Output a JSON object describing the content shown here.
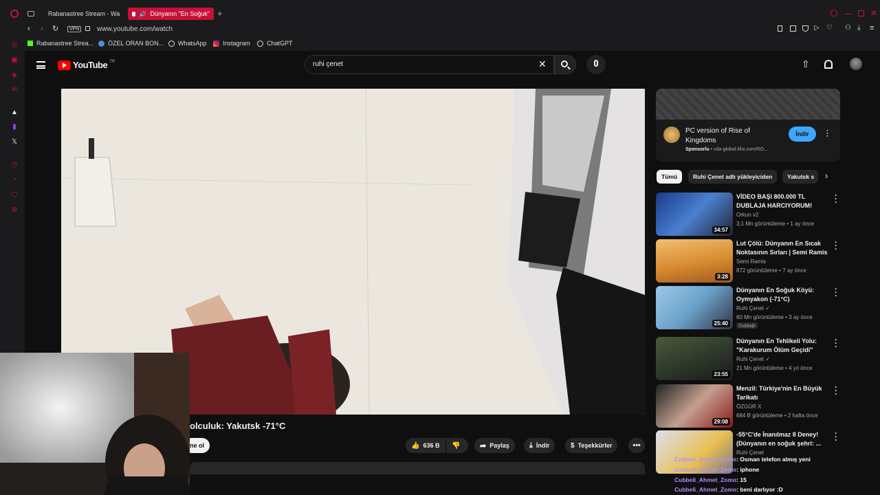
{
  "browser": {
    "tabs": [
      {
        "label": "Rabanastree Stream - Wa",
        "active": false
      },
      {
        "label": "Dünyanın \"En Soğuk\"",
        "active": true
      }
    ],
    "url_badge": "VPN",
    "url": "www.youtube.com/watch",
    "bookmarks": [
      {
        "label": "Rabanastree Strea...",
        "icon": "kick-icon"
      },
      {
        "label": "ÖZEL ORAN BON...",
        "icon": "globe-icon"
      },
      {
        "label": "WhatsApp",
        "icon": "whatsapp-icon"
      },
      {
        "label": "Instagram",
        "icon": "instagram-icon"
      },
      {
        "label": "ChatGPT",
        "icon": "chatgpt-icon"
      }
    ]
  },
  "youtube": {
    "logo_text": "YouTube",
    "logo_region": "TR",
    "search_value": "ruhi çenet",
    "video_title": "olculuk: Yakutsk -71°C",
    "subscribe_label": "ne ol",
    "like_count": "636 B",
    "share_label": "Paylaş",
    "download_label": "İndir",
    "thanks_label": "Teşekkürler"
  },
  "ad": {
    "title": "PC version of Rise of Kingdoms",
    "sponsor": "Sponsorlu",
    "domain": "vda-global.lilisi.com/RO...",
    "cta": "İndir"
  },
  "chips": [
    "Tümü",
    "Ruhi Çenet adlı yükleyiciden",
    "Yakutsk s"
  ],
  "recommended": [
    {
      "title": "VİDEO BAŞI 800.000 TL DUBLAJA HARCIYORUM! Ruhi...",
      "channel": "Orkun v2",
      "meta": "3,1 Mn görüntüleme • 1 ay önce",
      "duration": "34:57",
      "badge": ""
    },
    {
      "title": "Lut Çölü: Dünyanın En Sıcak Noktasının Sırları | Semi Ramis",
      "channel": "Semi Ramis",
      "meta": "872 görüntüleme • 7 ay önce",
      "duration": "3:28",
      "badge": ""
    },
    {
      "title": "Dünyanın En Soğuk Köyü: Oymyakon (-71°C)",
      "channel": "Ruhi Çenet",
      "meta": "60 Mn görüntüleme • 3 ay önce",
      "duration": "25:40",
      "badge": "Dublajlı"
    },
    {
      "title": "Dünyanın En Tehlikeli Yolu: \"Karakurum Ölüm Geçidi\"",
      "channel": "Ruhi Çenet",
      "meta": "21 Mn görüntüleme • 4 yıl önce",
      "duration": "23:55",
      "badge": ""
    },
    {
      "title": "Menzil: Türkiye'nin En Büyük Tarikatı",
      "channel": "ÖZGÜR X",
      "meta": "684 B görüntüleme • 2 hafta önce",
      "duration": "29:08",
      "badge": ""
    },
    {
      "title": "-55°C'de İnanılmaz 8 Deney! (Dünyanın en soğuk şehri: ...",
      "channel": "Ruhi Çenet",
      "meta": "",
      "duration": "",
      "badge": ""
    }
  ],
  "chat": [
    {
      "user": "Cubbeli_Ahmet_Zomo",
      "message": ": Osman telefon almış yeni"
    },
    {
      "user": "Cubbeli_Ahmet_Zomo",
      "message": ": iphone"
    },
    {
      "user": "Cubbeli_Ahmet_Zomo",
      "message": ": 15"
    },
    {
      "user": "Cubbeli_Ahmet_Zomo",
      "message": ": beni darlıyor :D"
    }
  ]
}
